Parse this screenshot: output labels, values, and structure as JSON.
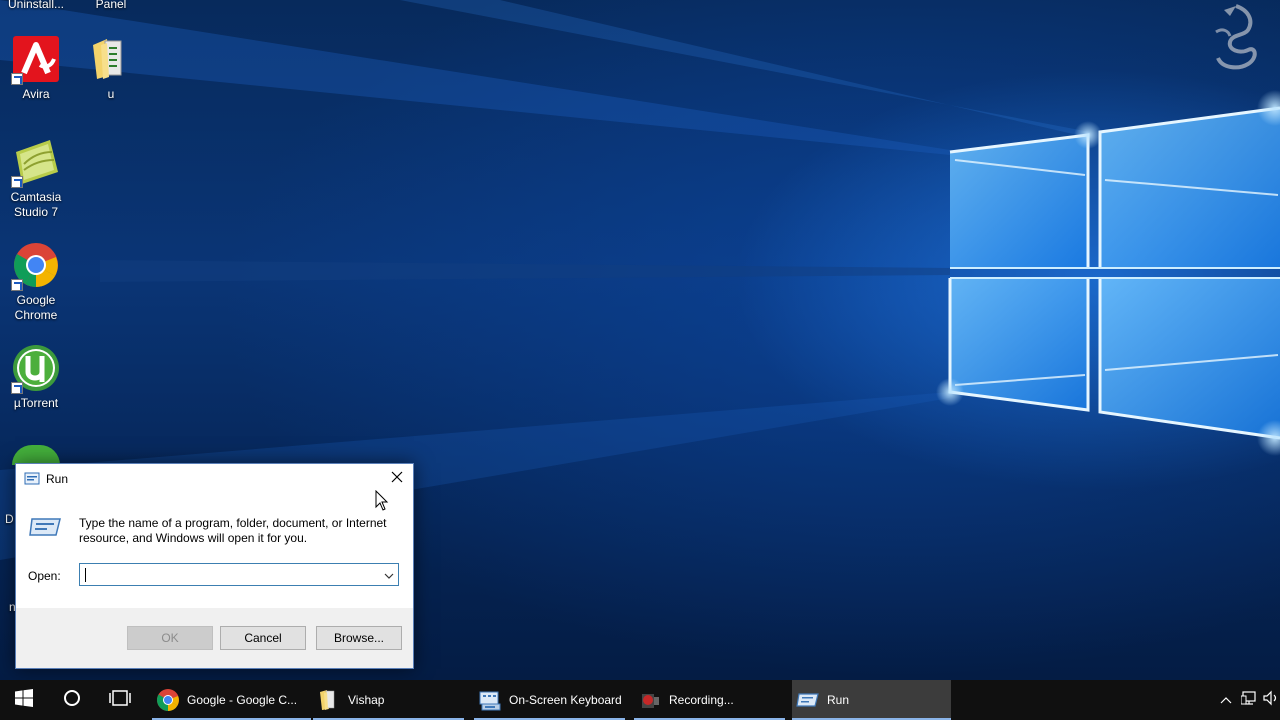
{
  "desktop": {
    "top_labels": [
      "Uninstall...",
      "Panel"
    ],
    "icons": [
      {
        "label": "Avira",
        "icon": "avira-icon"
      },
      {
        "label": "u",
        "icon": "folder-icon"
      },
      {
        "label": "Camtasia Studio 7",
        "icon": "camtasia-icon"
      },
      {
        "label": "Google Chrome",
        "icon": "chrome-icon"
      },
      {
        "label": "µTorrent",
        "icon": "utorrent-icon"
      }
    ],
    "partial_labels": [
      "D",
      "n"
    ]
  },
  "run_dialog": {
    "title": "Run",
    "description": "Type the name of a program, folder, document, or Internet resource, and Windows will open it for you.",
    "open_label": "Open:",
    "open_value": "",
    "ok_label": "OK",
    "cancel_label": "Cancel",
    "browse_label": "Browse..."
  },
  "taskbar": {
    "apps": [
      {
        "label": "Google - Google C...",
        "icon": "chrome-icon",
        "active": false
      },
      {
        "label": "Vishap",
        "icon": "folder-icon",
        "active": false
      },
      {
        "label": "On-Screen Keyboard",
        "icon": "keyboard-icon",
        "active": false
      },
      {
        "label": "Recording...",
        "icon": "recording-icon",
        "active": false
      },
      {
        "label": "Run",
        "icon": "run-icon",
        "active": true
      }
    ]
  },
  "colors": {
    "taskbar": "#101010",
    "active_underline": "#8ab4e8",
    "dialog_border": "#5a7fb8",
    "input_border": "#3c7fb1"
  }
}
